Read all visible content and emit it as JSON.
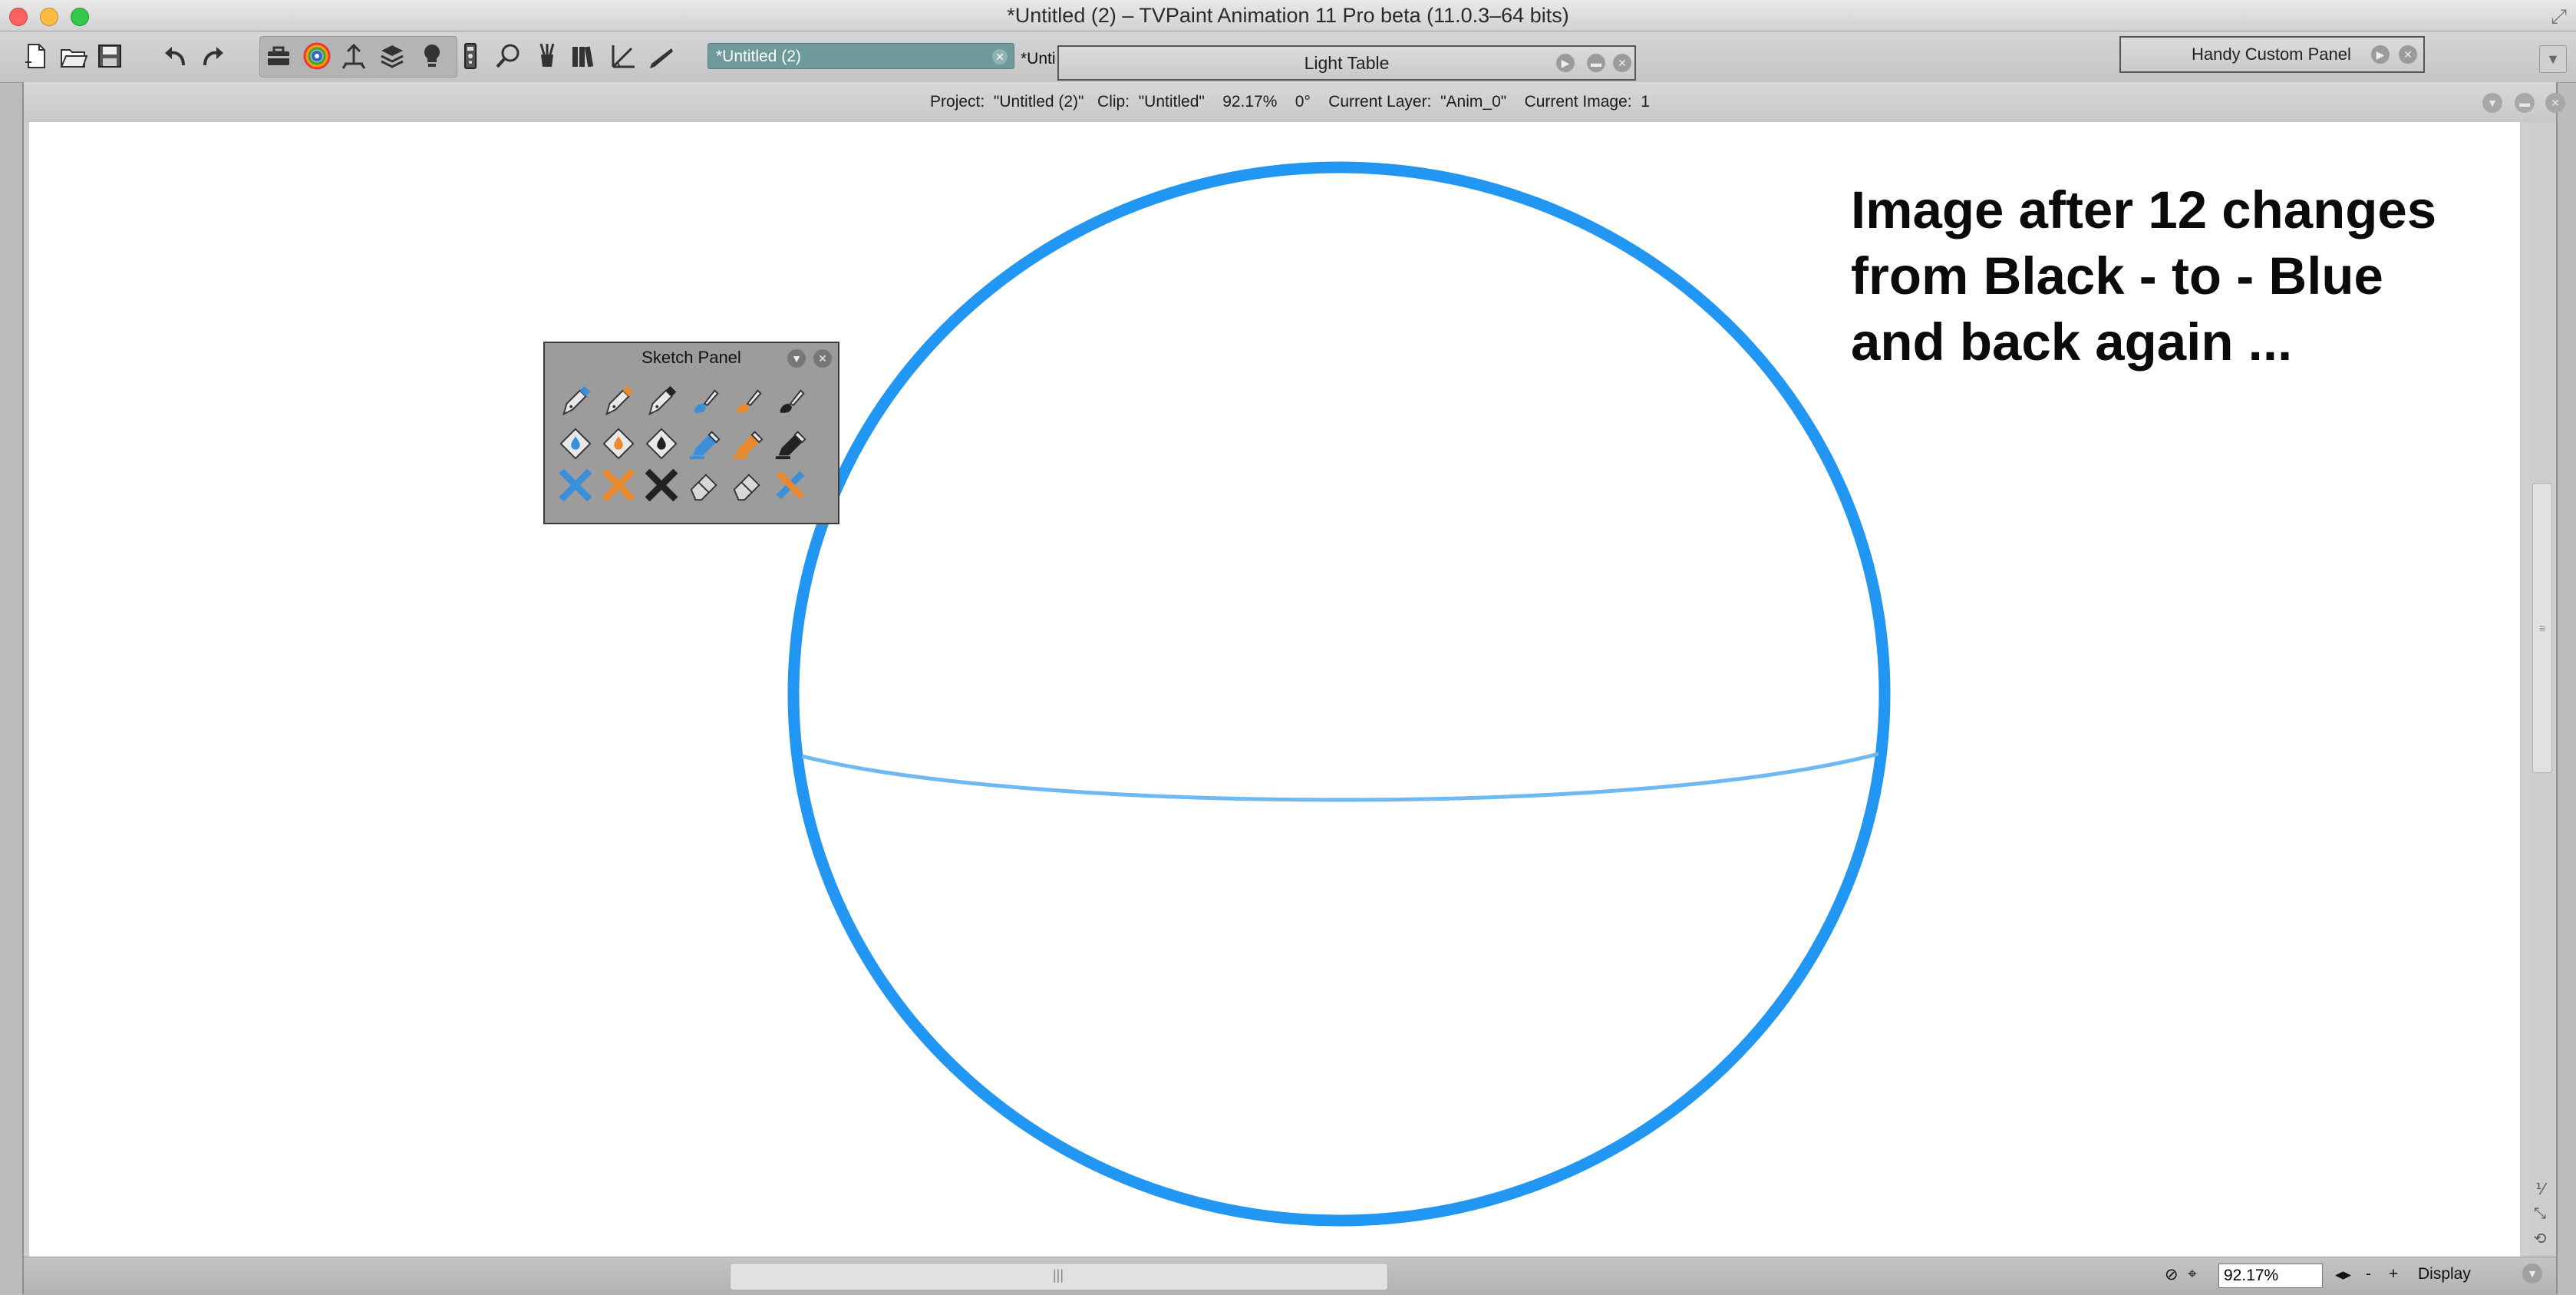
{
  "window": {
    "title": "*Untitled (2) – TVPaint Animation 11 Pro beta (11.0.3–64 bits)"
  },
  "toolbar": {
    "icons": [
      "new-document-icon",
      "open-folder-icon",
      "save-icon",
      "undo-icon",
      "redo-icon",
      "toolbox-icon",
      "color-wheel-icon",
      "timeline-icon",
      "layers-icon",
      "lightbulb-icon",
      "remote-icon",
      "search-icon",
      "brush-cup-icon",
      "books-icon",
      "angle-ruler-icon",
      "pen-icon"
    ],
    "project_tab": "*Untitled (2)",
    "project_tab_2": "*Unti",
    "light_table_title": "Light Table",
    "handy_panel_title": "Handy Custom Panel"
  },
  "viewer": {
    "status": {
      "project_label": "Project:",
      "project_value": "\"Untitled (2)\"",
      "clip_label": "Clip:",
      "clip_value": "\"Untitled\"",
      "zoom": "92.17%",
      "angle": "0°",
      "layer_label": "Current Layer:",
      "layer_value": "\"Anim_0\"",
      "image_label": "Current Image:",
      "image_value": "1"
    },
    "zoom_value": "92.17%",
    "display_label": "Display",
    "zoom_minus": "-",
    "zoom_plus": "+"
  },
  "canvas": {
    "annotation": [
      "Image after 12 changes",
      "from Black - to - Blue",
      "and back again  ..."
    ],
    "stroke_color": "#2196f3",
    "equator_color": "#6fb9f3"
  },
  "sketch_panel": {
    "title": "Sketch Panel",
    "tools": [
      {
        "name": "pen-blue-icon",
        "color": "#3a8fd8"
      },
      {
        "name": "pen-orange-icon",
        "color": "#e8892e"
      },
      {
        "name": "pen-black-icon",
        "color": "#222222"
      },
      {
        "name": "brush-blue-icon",
        "color": "#3a8fd8"
      },
      {
        "name": "brush-orange-icon",
        "color": "#e8892e"
      },
      {
        "name": "brush-black-icon",
        "color": "#222222"
      },
      {
        "name": "fill-blue-icon",
        "color": "#3a8fd8"
      },
      {
        "name": "fill-orange-icon",
        "color": "#e8892e"
      },
      {
        "name": "fill-black-icon",
        "color": "#222222"
      },
      {
        "name": "marker-blue-icon",
        "color": "#3a8fd8"
      },
      {
        "name": "marker-orange-icon",
        "color": "#e8892e"
      },
      {
        "name": "marker-black-icon",
        "color": "#222222"
      },
      {
        "name": "clear-blue-icon",
        "color": "#3a8fd8"
      },
      {
        "name": "clear-orange-icon",
        "color": "#e8892e"
      },
      {
        "name": "clear-black-icon",
        "color": "#222222"
      },
      {
        "name": "eraser-icon",
        "color": "#d8d8d8"
      },
      {
        "name": "eraser-soft-icon",
        "color": "#d8d8d8"
      },
      {
        "name": "clear-multi-icon",
        "color": "#e8892e"
      }
    ]
  }
}
